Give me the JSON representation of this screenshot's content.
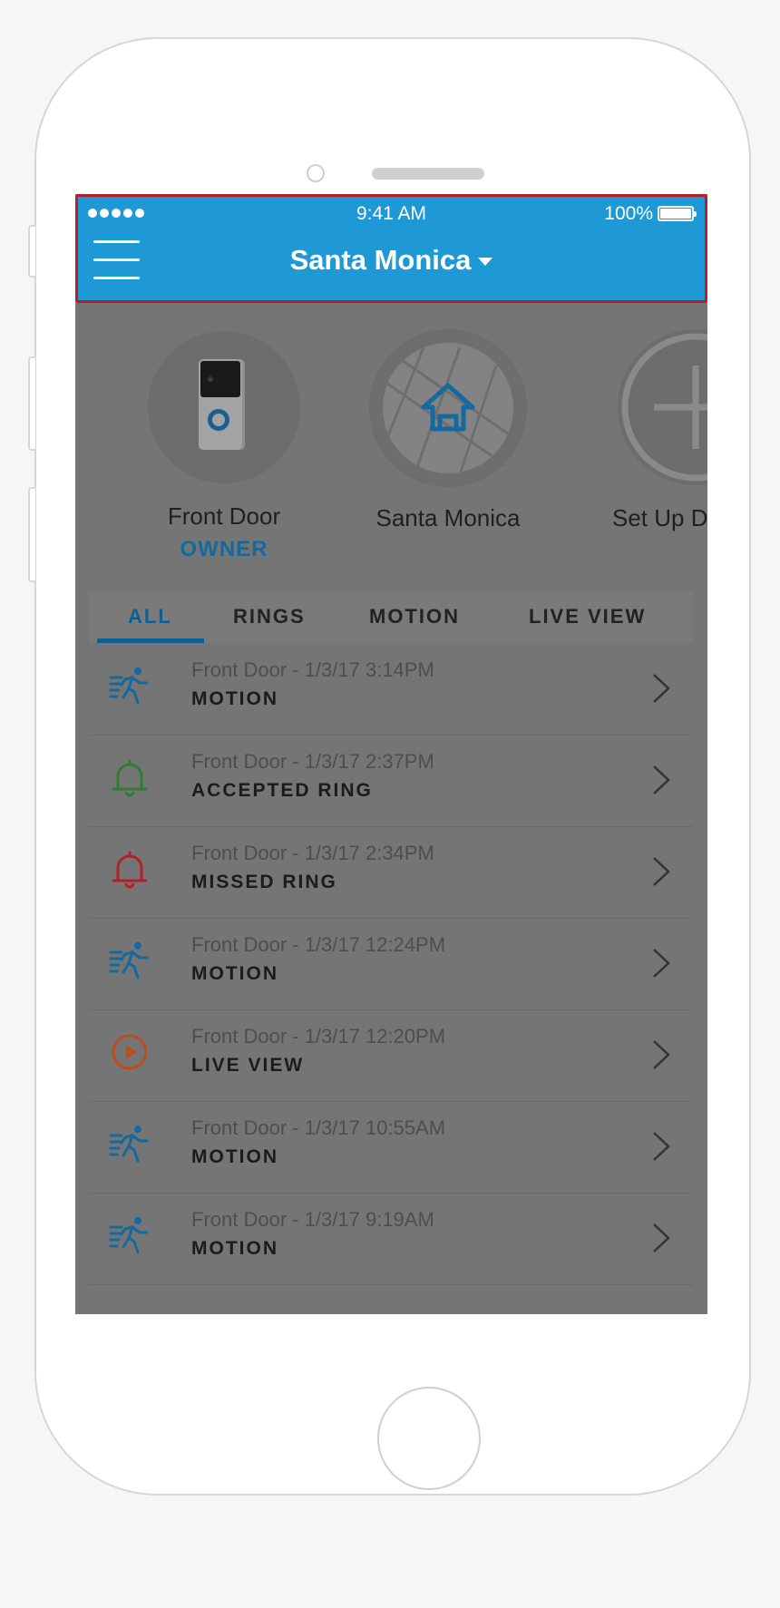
{
  "status_bar": {
    "time": "9:41 AM",
    "battery": "100%"
  },
  "header": {
    "location": "Santa Monica"
  },
  "devices": [
    {
      "name": "Front Door",
      "role": "OWNER"
    },
    {
      "name": "Santa Monica"
    },
    {
      "name": "Set Up Device"
    }
  ],
  "tabs": [
    "ALL",
    "RINGS",
    "MOTION",
    "LIVE VIEW"
  ],
  "active_tab": "ALL",
  "events": [
    {
      "title": "Front Door - 1/3/17 3:14PM",
      "type": "MOTION",
      "icon": "motion-icon"
    },
    {
      "title": "Front Door - 1/3/17 2:37PM",
      "type": "ACCEPTED RING",
      "icon": "bell-icon"
    },
    {
      "title": "Front Door - 1/3/17 2:34PM",
      "type": "MISSED RING",
      "icon": "bell-icon"
    },
    {
      "title": "Front Door - 1/3/17 12:24PM",
      "type": "MOTION",
      "icon": "motion-icon"
    },
    {
      "title": "Front Door - 1/3/17 12:20PM",
      "type": "LIVE VIEW",
      "icon": "play-icon"
    },
    {
      "title": "Front Door - 1/3/17 10:55AM",
      "type": "MOTION",
      "icon": "motion-icon"
    },
    {
      "title": "Front Door - 1/3/17 9:19AM",
      "type": "MOTION",
      "icon": "motion-icon"
    }
  ],
  "colors": {
    "header_blue": "#1e99d6",
    "highlight_border": "#b4202a",
    "motion": "#1469a0",
    "accepted_ring": "#2e7d32",
    "missed_ring": "#b3202a",
    "live_view": "#b8501e"
  }
}
